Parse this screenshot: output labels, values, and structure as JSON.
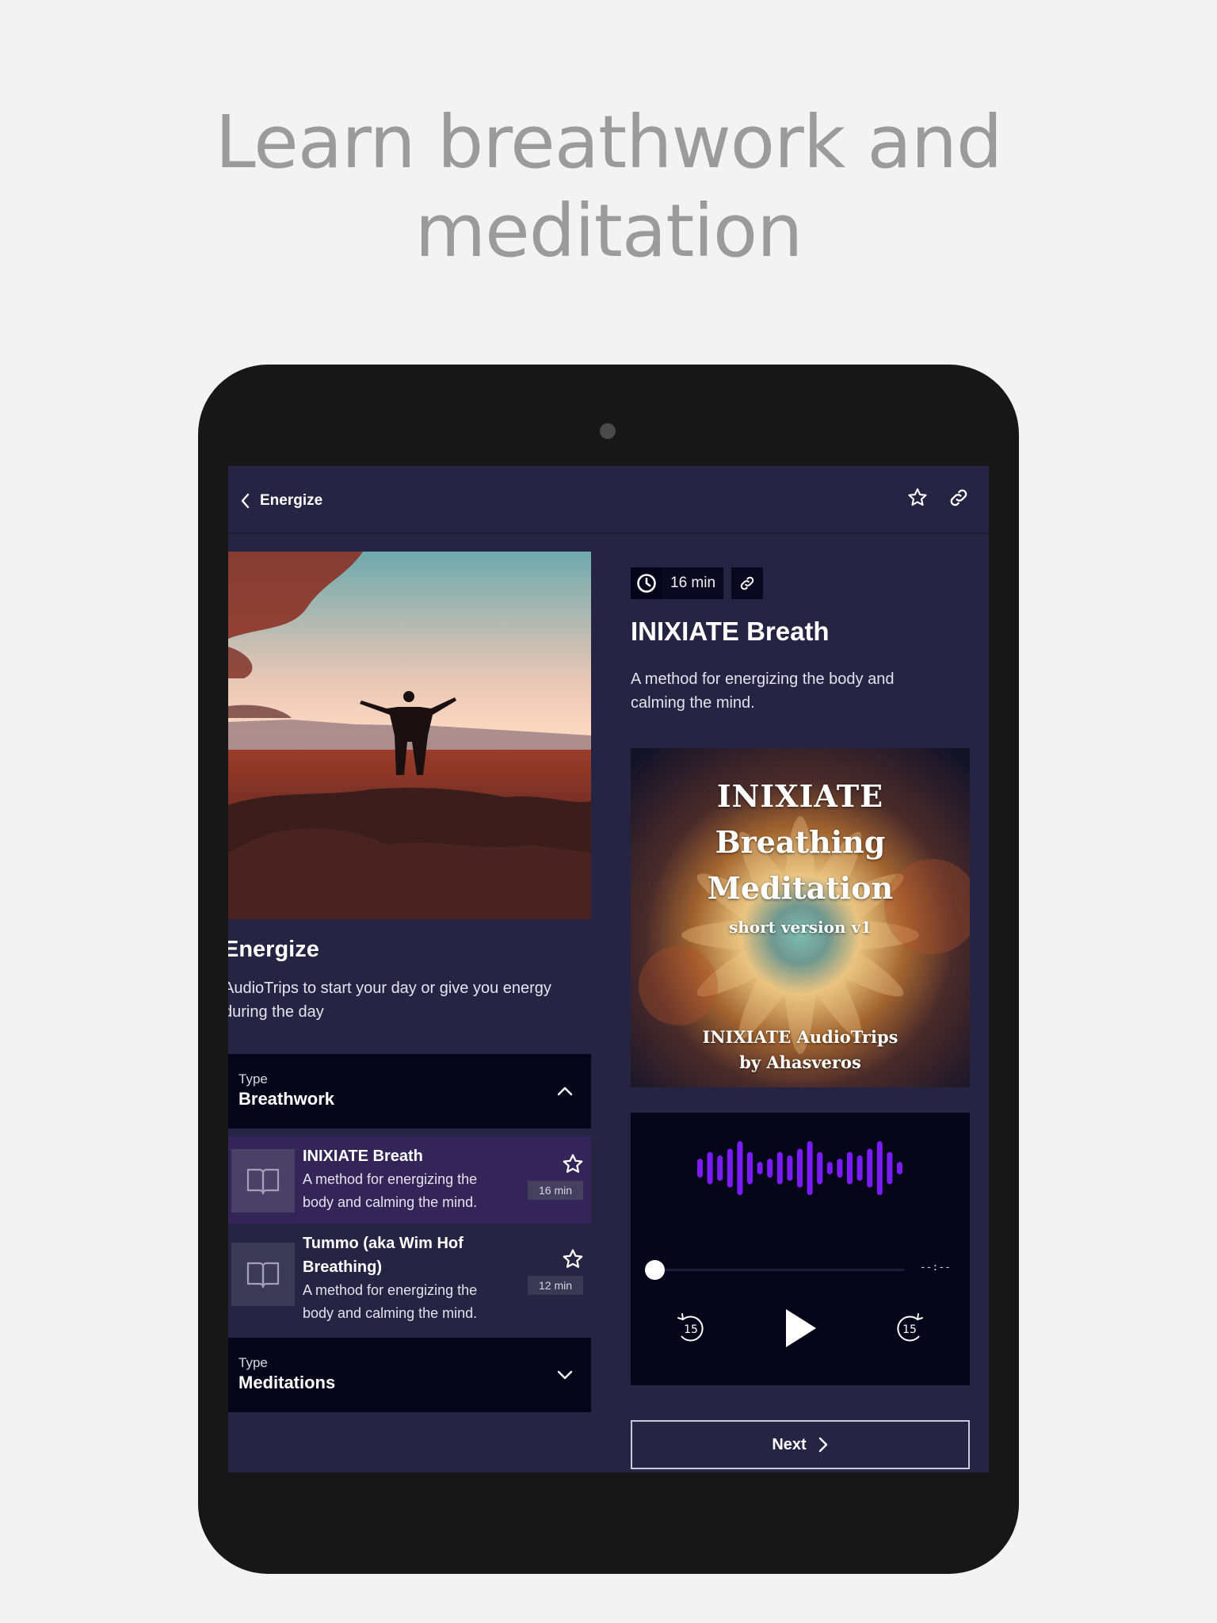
{
  "headline": [
    "Learn breathwork and",
    "meditation"
  ],
  "appbar": {
    "back_label": "Energize",
    "favorite_icon": "star-outline-icon",
    "share_icon": "link-icon"
  },
  "collection": {
    "title": "Energize",
    "description": "AudioTrips to start your day or give you energy during the day",
    "hero_image": "person-arms-raised-sunset-photo"
  },
  "groups": [
    {
      "label": "Type",
      "value": "Breathwork",
      "expanded": true,
      "tracks": [
        {
          "title": "INIXIATE Breath",
          "description": "A method for energizing the body and calming the mind.",
          "duration": "16 min",
          "active": true
        },
        {
          "title": "Tummo (aka Wim Hof Breathing)",
          "description": "A method for energizing the body and calming the mind.",
          "duration": "12 min",
          "active": false
        }
      ]
    },
    {
      "label": "Type",
      "value": "Meditations",
      "expanded": false,
      "tracks": []
    }
  ],
  "detail": {
    "duration": "16 min",
    "title": "INIXIATE Breath",
    "description": "A method for energizing the body and calming the mind.",
    "cover": {
      "line1": "INIXIATE",
      "line2": "Breathing",
      "line3": "Meditation",
      "line4": "short version v1",
      "line5": "INIXIATE AudioTrips",
      "line6": "by Ahasveros"
    }
  },
  "player": {
    "progress": 0,
    "time_remaining": "--:--",
    "rewind_seconds": "15",
    "forward_seconds": "15",
    "state": "paused",
    "waveform_color": "#7a1cf5",
    "waveform_levels": [
      0.35,
      0.6,
      0.47,
      0.72,
      1.0,
      0.6,
      0.23,
      0.35,
      0.6,
      0.47,
      0.72,
      1.0,
      0.6,
      0.23,
      0.35,
      0.6,
      0.47,
      0.72,
      1.0,
      0.6,
      0.23
    ]
  },
  "next_button": {
    "label": "Next"
  },
  "colors": {
    "screen_bg": "#252443",
    "panel_dark": "#06051a",
    "active_row": "#332558",
    "accent_purple": "#7a1cf5",
    "page_bg": "#f3f3f3",
    "headline": "#9b9b9b"
  }
}
